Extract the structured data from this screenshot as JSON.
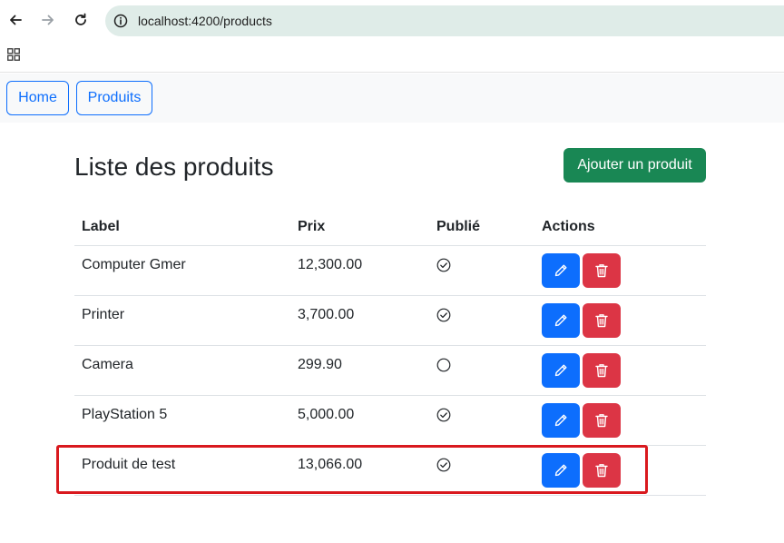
{
  "browser": {
    "url": "localhost:4200/products",
    "icons": {
      "back": "arrow-left-icon",
      "forward": "arrow-right-icon",
      "reload": "reload-icon",
      "site_info": "info-icon",
      "apps": "apps-grid-icon"
    }
  },
  "navbar": {
    "home_label": "Home",
    "produits_label": "Produits"
  },
  "page": {
    "title": "Liste des produits",
    "add_button_label": "Ajouter un produit"
  },
  "table": {
    "headers": {
      "label": "Label",
      "prix": "Prix",
      "publie": "Publié",
      "actions": "Actions"
    },
    "rows": [
      {
        "label": "Computer Gmer",
        "prix": "12,300.00",
        "published": true
      },
      {
        "label": "Printer",
        "prix": "3,700.00",
        "published": true
      },
      {
        "label": "Camera",
        "prix": "299.90",
        "published": false
      },
      {
        "label": "PlayStation 5",
        "prix": "5,000.00",
        "published": true
      },
      {
        "label": "Produit de test",
        "prix": "13,066.00",
        "published": true
      }
    ],
    "action_icons": {
      "edit": "pencil-icon",
      "delete": "trash-icon"
    }
  },
  "colors": {
    "primary": "#0d6efd",
    "success": "#198754",
    "danger": "#dc3545",
    "annotation": "#d9191e",
    "address_bar": "#dfece8"
  }
}
